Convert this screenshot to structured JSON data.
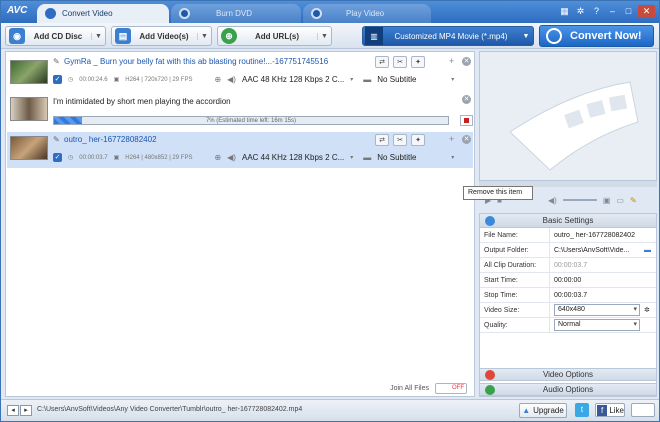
{
  "app": {
    "logo": "AVC",
    "tabs": [
      {
        "label": "Convert Video",
        "active": true
      },
      {
        "label": "Burn DVD",
        "active": false
      },
      {
        "label": "Play Video",
        "active": false
      }
    ]
  },
  "toolbar": {
    "add_cd": "Add CD Disc",
    "add_videos": "Add Video(s)",
    "add_urls": "Add URL(s)",
    "profile": "Customized MP4 Movie (*.mp4)",
    "convert": "Convert Now!"
  },
  "files": [
    {
      "title": "GymRa _ Burn your belly fat with this ab blasting routine!...-167751745516",
      "duration": "00:00:24.6",
      "video": "H264 | 720x720 | 29 FPS",
      "audio": "AAC 48 KHz 128 Kbps 2 C...",
      "subtitle": "No Subtitle"
    },
    {
      "title": "I'm intimidated by short men playing the accordion",
      "progress_text": "7% (Estimated time left: 16m 15s)",
      "progress": 0.07
    },
    {
      "title": "outro_ her-167728082402",
      "duration": "00:00:03.7",
      "video": "H264 | 480x852 | 29 FPS",
      "audio": "AAC 44 KHz 128 Kbps 2 C...",
      "subtitle": "No Subtitle"
    }
  ],
  "join": {
    "label": "Join All Files",
    "state": "OFF"
  },
  "tooltip": "Remove this item",
  "settings": {
    "header": "Basic Settings",
    "rows": [
      {
        "key": "File Name:",
        "value": "outro_ her-167728082402"
      },
      {
        "key": "Output Folder:",
        "value": "C:\\Users\\AnvSoft\\Vide..."
      },
      {
        "key": "All Clip Duration:",
        "value": "00:00:03.7"
      },
      {
        "key": "Start Time:",
        "value": "00:00:00"
      },
      {
        "key": "Stop Time:",
        "value": "00:00:03.7"
      },
      {
        "key": "Video Size:",
        "value": "640x480"
      },
      {
        "key": "Quality:",
        "value": "Normal"
      }
    ],
    "video_options": "Video Options",
    "audio_options": "Audio Options"
  },
  "status": {
    "path": "C:\\Users\\AnvSoft\\Videos\\Any Video Converter\\Tumblr\\outro_ her-167728082402.mp4",
    "upgrade": "Upgrade",
    "like": "Like"
  },
  "colors": {
    "accent": "#2d6cc0",
    "selected_row": "#cfe0f7",
    "progress": "#2f7ae0"
  }
}
